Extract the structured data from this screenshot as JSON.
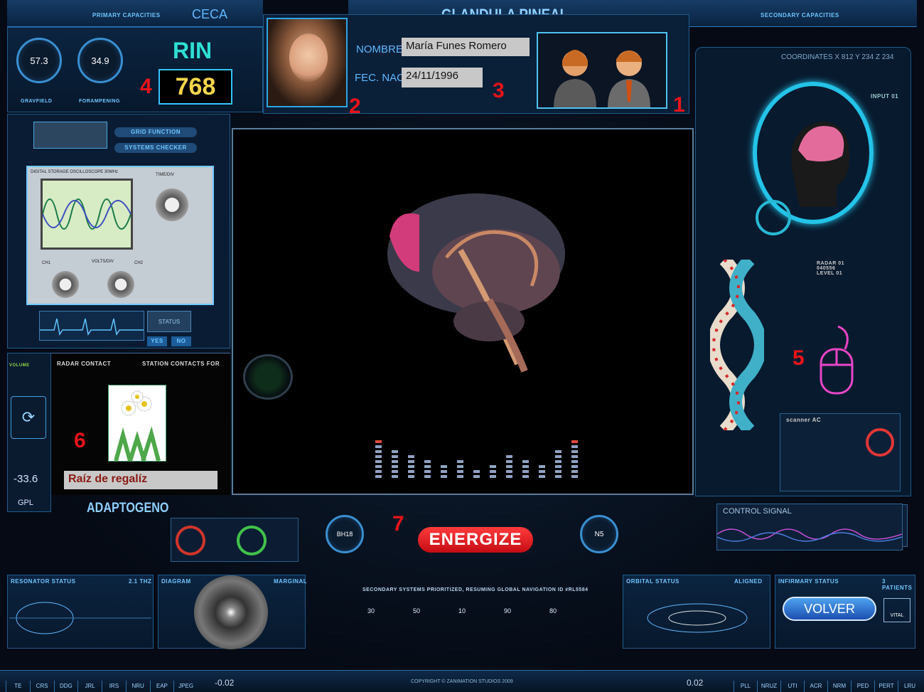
{
  "header": {
    "primary_capacities": "PRIMARY CAPACITIES",
    "ceca": "CECA",
    "title": "GLANDULA PINEAL",
    "secondary_capacities": "SECONDARY CAPACITIES"
  },
  "left_top": {
    "dial1_value": "57.3",
    "dial1_label": "GRAVFIELD",
    "dial2_value": "34.9",
    "dial2_label": "FORAMPENING",
    "rin_label": "RIN",
    "rin_value": "768",
    "marker": "4"
  },
  "patient": {
    "nombre_label": "NOMBRE",
    "nombre_value": "María Funes Romero",
    "fec_label": "FEC. NAC.",
    "fec_value": "24/11/1996",
    "marker_photo": "2",
    "marker_fields": "3",
    "marker_avatars": "1"
  },
  "left_panel": {
    "grid_function": "GRID FUNCTION",
    "systems_checker": "SYSTEMS CHECKER",
    "oscilloscope_title": "DIGITAL STORAGE OSCILLOSCOPE 30MHz",
    "time_div": "TIME/DIV",
    "volt_div": "VOLTS/DIV",
    "ch1": "CH1",
    "ch2": "CH2",
    "yes": "YES",
    "no": "NO",
    "status": "STATUS",
    "radar_contact": "RADAR CONTACT",
    "station_contacts": "STATION CONTACTS FOR",
    "volume": "VOLUME",
    "reading": "-33.6",
    "gpl": "GPL",
    "marker": "6",
    "remedy_value": "Raíz de regalíz",
    "adaptogen": "ADAPTOGENO"
  },
  "right_panel": {
    "coordinates": "COORDINATES  X 812  Y 234  Z 234",
    "input": "INPUT 01",
    "radar": "RADAR 01",
    "radar_value": "040556",
    "level": "LEVEL 01",
    "scanner": "scanner AC",
    "marker": "5",
    "control_signal": "CONTROL SIGNAL"
  },
  "center": {
    "marker": "7",
    "energize": "ENERGIZE",
    "dial_left": "BH18",
    "dial_right": "N5"
  },
  "bottom": {
    "resonator_status": "RESONATOR STATUS",
    "resonator_value": "2.1 THz",
    "diagram": "DIAGRAM",
    "marginal": "MARGINAL",
    "secondary_msg": "SECONDARY SYSTEMS PRIORITIZED, RESUMING GLOBAL NAVIGATION ID #RL5584",
    "scale": [
      "30",
      "50",
      "10",
      "90",
      "80"
    ],
    "orbital_status": "ORBITAL STATUS",
    "aligned": "ALIGNED",
    "infirmary_status": "INFIRMARY STATUS",
    "patients": "3 PATIENTS",
    "volver": "VOLVER",
    "vital": "VITAL",
    "copyright": "COPYRIGHT © ZANIMATION STUDIOS 2009",
    "left_reading": "-0.02",
    "right_reading": "0.02",
    "tabs_left": [
      "TE",
      "CRS",
      "DDG",
      "JRL",
      "IRS",
      "NRU",
      "EAP",
      "JPEG"
    ],
    "tabs_right": [
      "PLL",
      "NRUZ",
      "UTI",
      "ACR",
      "NRM",
      "PED",
      "PERT",
      "LRU"
    ]
  },
  "colors": {
    "accent": "#5fb8ff",
    "marker_red": "#e8141a",
    "energize_red": "#e31d25"
  }
}
